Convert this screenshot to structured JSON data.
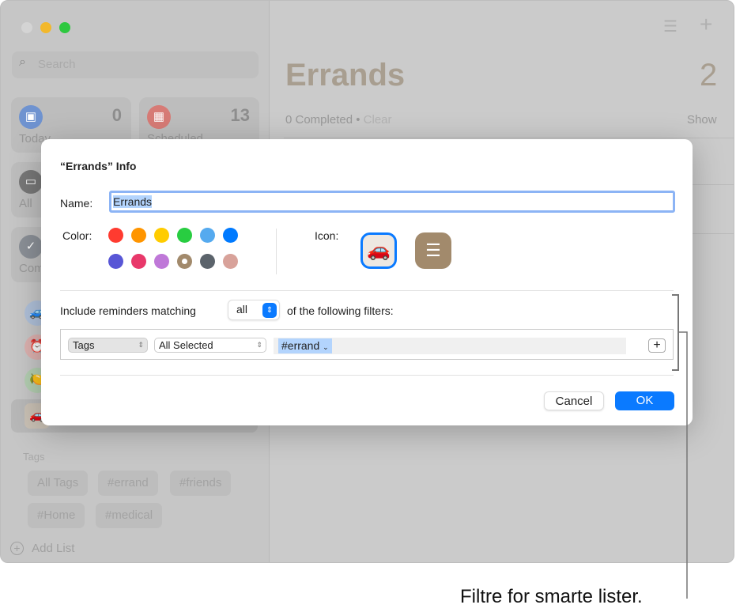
{
  "window_controls": {
    "close": "#d4d4d4",
    "minimize": "#f2b82c",
    "zoom": "#2ec840"
  },
  "sidebar": {
    "search_placeholder": "Search",
    "smart_lists": [
      {
        "label": "Today",
        "count": "0",
        "icon": "calendar-icon",
        "color": "#6f93d0"
      },
      {
        "label": "Scheduled",
        "count": "13",
        "icon": "calendar-grid-icon",
        "color": "#d77b76"
      },
      {
        "label": "All",
        "icon": "tray-icon",
        "color": "#777777"
      },
      {
        "label": "Completed",
        "icon": "checkmark-icon",
        "color": "#8a8f96"
      }
    ],
    "lists": [
      {
        "icon": "car-icon",
        "emoji": "🚙"
      },
      {
        "icon": "alarm-clock-icon",
        "emoji": "⏰"
      },
      {
        "icon": "lemon-icon",
        "emoji": "🍋"
      },
      {
        "icon": "car-icon",
        "emoji": "🚗",
        "selected": true
      }
    ],
    "tags_header": "Tags",
    "tags": [
      "All Tags",
      "#errand",
      "#friends",
      "#Home",
      "#medical"
    ],
    "add_list": "Add List"
  },
  "main": {
    "title": "Errands",
    "count": "2",
    "completed": "0 Completed",
    "clear": "Clear",
    "show": "Show"
  },
  "dialog": {
    "title": "“Errands” Info",
    "name_label": "Name:",
    "name_value": "Errands",
    "color_label": "Color:",
    "colors": [
      "#ff3b30",
      "#ff9500",
      "#ffcc00",
      "#28cd41",
      "#55aaef",
      "#007aff",
      "#5856d6",
      "#e8386a",
      "#bf78d8",
      "#a28a6c",
      "#5b636b",
      "#d8a29a"
    ],
    "selected_color": "#a28a6c",
    "icon_label": "Icon:",
    "icons": [
      {
        "name": "car-icon",
        "emoji": "🚗",
        "selected": true
      },
      {
        "name": "list-icon",
        "glyph": "☰",
        "color": "#a28a6c"
      }
    ],
    "filter_prefix": "Include reminders matching",
    "match_value": "all",
    "filter_suffix": "of the following filters:",
    "filter_row": {
      "field": "Tags",
      "condition": "All Selected",
      "token": "#errand"
    },
    "cancel": "Cancel",
    "ok": "OK"
  },
  "annotation": "Filtre for smarte lister.",
  "accent": "#0a7aff"
}
